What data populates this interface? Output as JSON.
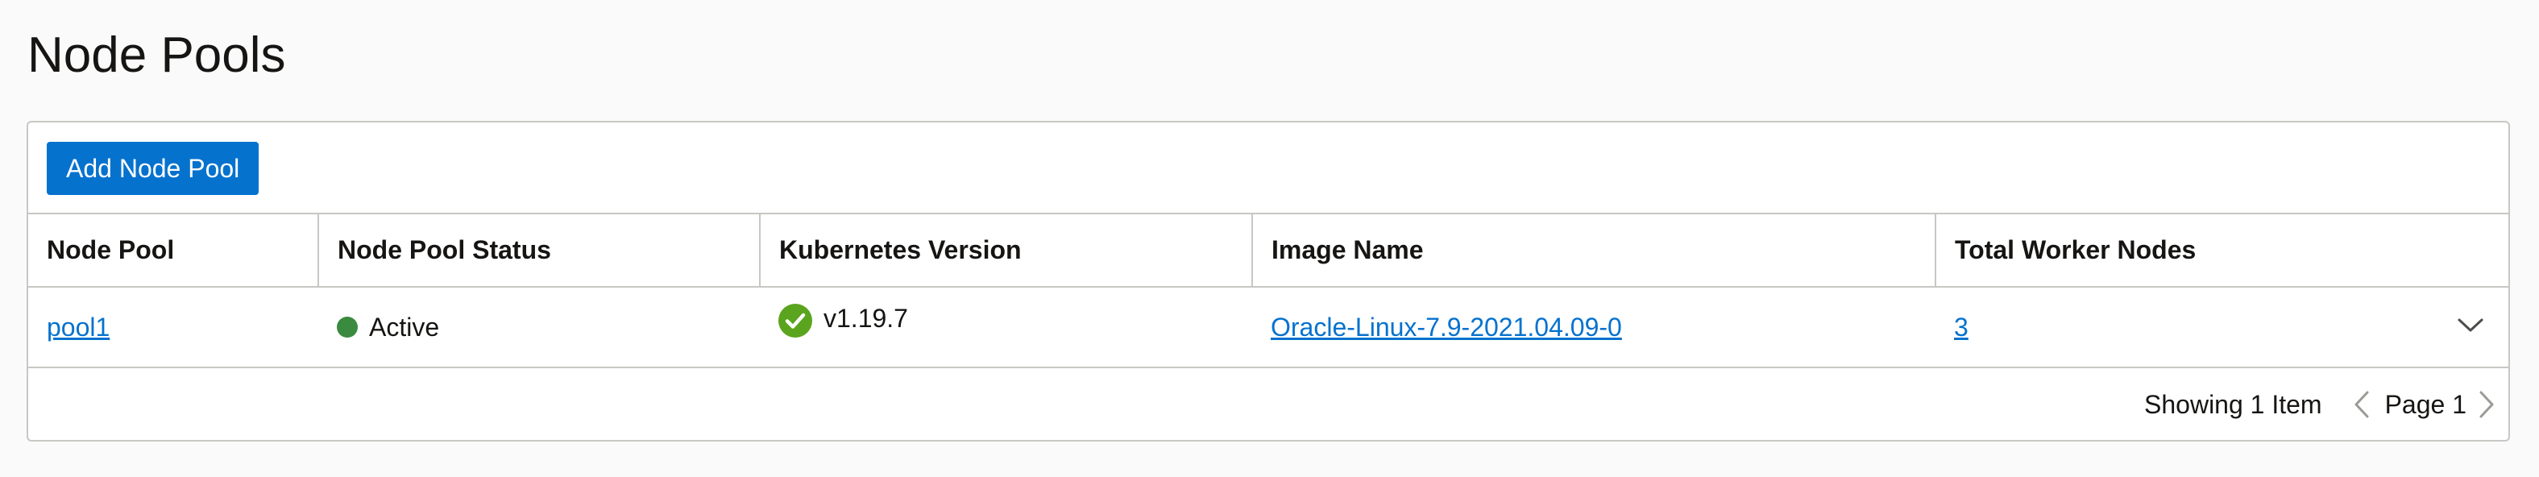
{
  "page": {
    "title": "Node Pools"
  },
  "toolbar": {
    "add_button_label": "Add Node Pool"
  },
  "table": {
    "columns": [
      "Node Pool",
      "Node Pool Status",
      "Kubernetes Version",
      "Image Name",
      "Total Worker Nodes"
    ],
    "rows": [
      {
        "node_pool": "pool1",
        "status": "Active",
        "status_color": "#3a8a3f",
        "kubernetes_version": "v1.19.7",
        "version_icon": "check-circle-icon",
        "image_name": "Oracle-Linux-7.9-2021.04.09-0",
        "total_worker_nodes": "3",
        "expand_icon": "chevron-down-icon"
      }
    ]
  },
  "footer": {
    "count_text": "Showing 1 Item",
    "page_text": "Page 1"
  },
  "colors": {
    "accent": "#0572ce",
    "active_status": "#3a8a3f",
    "check_icon": "#5aa41e"
  }
}
